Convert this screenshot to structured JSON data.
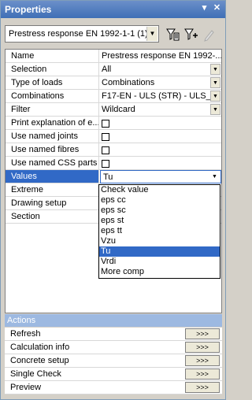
{
  "window": {
    "title": "Properties",
    "pin_glyph": "▾",
    "close_glyph": "✕"
  },
  "toolbar": {
    "combo_value": "Prestress response EN 1992-1-1 (1)",
    "icons": [
      "filter-icon",
      "filter-add-icon",
      "pencil-icon"
    ]
  },
  "properties": {
    "name": {
      "label": "Name",
      "value": "Prestress response EN 1992-..."
    },
    "selection": {
      "label": "Selection",
      "value": "All"
    },
    "type_of_loads": {
      "label": "Type of loads",
      "value": "Combinations"
    },
    "combinations": {
      "label": "Combinations",
      "value": "F17-EN - ULS (STR) - ULS_"
    },
    "filter": {
      "label": "Filter",
      "value": "Wildcard"
    },
    "print_explanation": {
      "label": "Print explanation of e..."
    },
    "use_named_joints": {
      "label": "Use named joints"
    },
    "use_named_fibres": {
      "label": "Use named fibres"
    },
    "use_named_css_parts": {
      "label": "Use named CSS parts"
    },
    "values": {
      "label": "Values",
      "value": "Tu"
    },
    "extreme": {
      "label": "Extreme"
    },
    "drawing_setup": {
      "label": "Drawing setup"
    },
    "section": {
      "label": "Section"
    }
  },
  "values_dropdown": {
    "options": [
      "Check value",
      "eps cc",
      "eps sc",
      "eps st",
      "eps tt",
      "Vzu",
      "Tu",
      "Vrdi",
      "More comp"
    ],
    "selected": "Tu"
  },
  "actions": {
    "header": "Actions",
    "button_label": ">>>",
    "items": [
      "Refresh",
      "Calculation info",
      "Concrete setup",
      "Single Check",
      "Preview"
    ]
  },
  "colors": {
    "selection": "#3169c6",
    "title_bar": "#4a7bc0",
    "actions_header": "#9db9e1"
  }
}
